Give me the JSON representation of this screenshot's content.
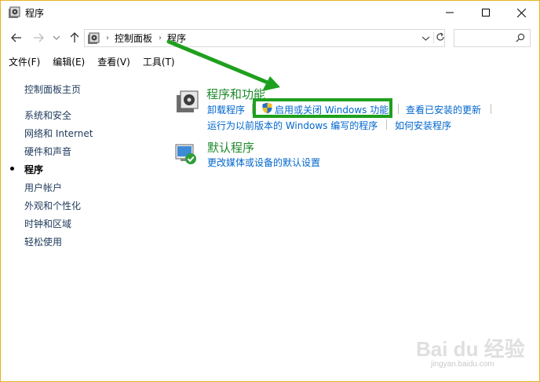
{
  "window": {
    "title": "程序"
  },
  "address": {
    "crumbs": [
      "控制面板",
      "程序"
    ]
  },
  "search": {
    "placeholder": ""
  },
  "menu": [
    "文件(F)",
    "编辑(E)",
    "查看(V)",
    "工具(T)"
  ],
  "leftnav": {
    "home": "控制面板主页",
    "items": [
      "系统和安全",
      "网络和 Internet",
      "硬件和声音",
      "程序",
      "用户帐户",
      "外观和个性化",
      "时钟和区域",
      "轻松使用"
    ],
    "active_index": 3
  },
  "categories": {
    "programs": {
      "title": "程序和功能",
      "links": [
        "卸载程序",
        "启用或关闭 Windows 功能",
        "查看已安装的更新",
        "运行为以前版本的 Windows 编写的程序",
        "如何安装程序"
      ]
    },
    "defaults": {
      "title": "默认程序",
      "links": [
        "更改媒体或设备的默认设置"
      ]
    }
  },
  "annotation": {
    "highlight_color": "#1ea01e",
    "arrow_color": "#1ea01e"
  },
  "watermark": {
    "brand": "Bai du 经验",
    "url": "jingyan.baidu.com"
  }
}
